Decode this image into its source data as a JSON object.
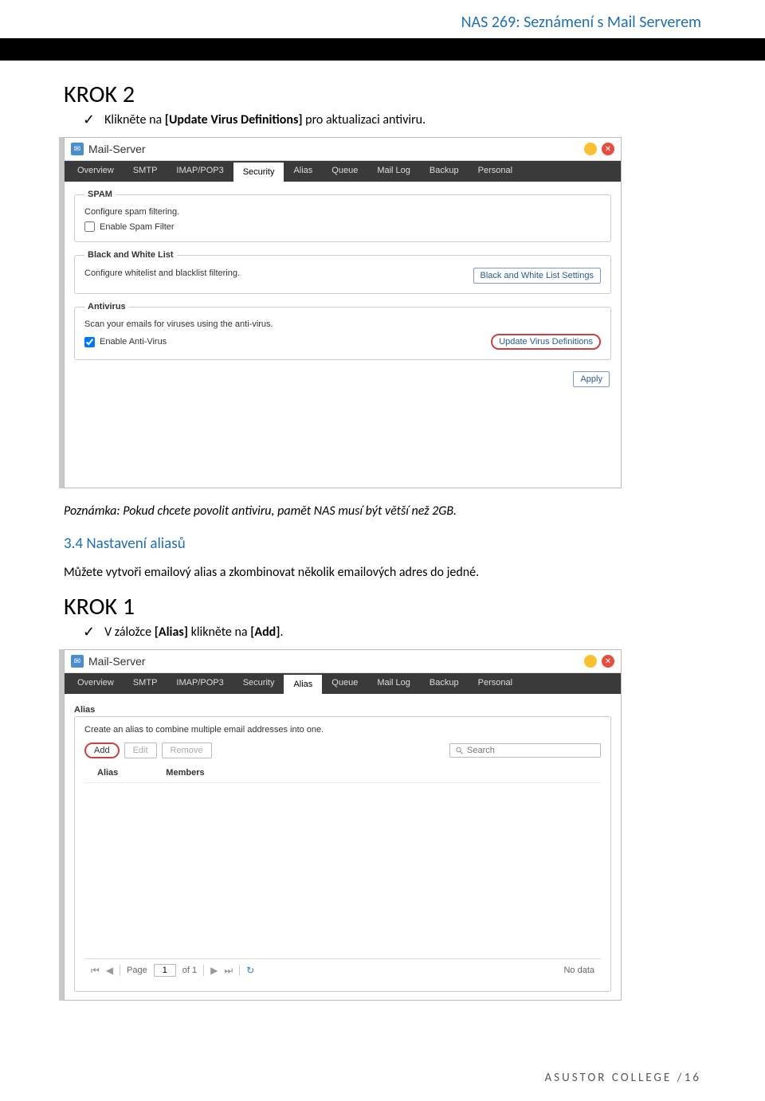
{
  "header": {
    "title": "NAS 269: Seznámení s Mail Serverem"
  },
  "krok2": {
    "heading": "KROK 2",
    "line": "Klikněte na ",
    "bold": "[Update Virus Definitions]",
    "line2": " pro aktualizaci antiviru."
  },
  "app_title": "Mail-Server",
  "tabs": [
    "Overview",
    "SMTP",
    "IMAP/POP3",
    "Security",
    "Alias",
    "Queue",
    "Mail Log",
    "Backup",
    "Personal"
  ],
  "sec_screenshot": {
    "active_tab": 3,
    "spam_legend": "SPAM",
    "spam_desc": "Configure spam filtering.",
    "spam_checkbox": "Enable Spam Filter",
    "bw_legend": "Black and White List",
    "bw_desc": "Configure whitelist and blacklist filtering.",
    "bw_button": "Black and White List Settings",
    "av_legend": "Antivirus",
    "av_desc": "Scan your emails for viruses using the anti-virus.",
    "av_checkbox": "Enable Anti-Virus",
    "av_button": "Update Virus Definitions",
    "apply": "Apply"
  },
  "note": "Poznámka: Pokud chcete povolit antiviru, pamět NAS musí být větší než 2GB.",
  "sec34_title": "3.4 Nastavení aliasů",
  "sec34_body": "Můžete vytvoři emailový alias a zkombinovat několik emailových adres do jedné.",
  "krok1": {
    "heading": "KROK 1",
    "line": "V záložce ",
    "bold1": "[Alias]",
    "mid": " klikněte na ",
    "bold2": "[Add]",
    "end": "."
  },
  "alias_screenshot": {
    "active_tab": 4,
    "legend": "Alias",
    "desc": "Create an alias to combine multiple email addresses into one.",
    "add": "Add",
    "edit": "Edit",
    "remove": "Remove",
    "search_placeholder": "Search",
    "col_alias": "Alias",
    "col_members": "Members",
    "page_label": "Page",
    "page_value": "1",
    "page_of": "of 1",
    "no_data": "No data"
  },
  "footer": {
    "text": "ASUSTOR COLLEGE",
    "page": "16"
  }
}
